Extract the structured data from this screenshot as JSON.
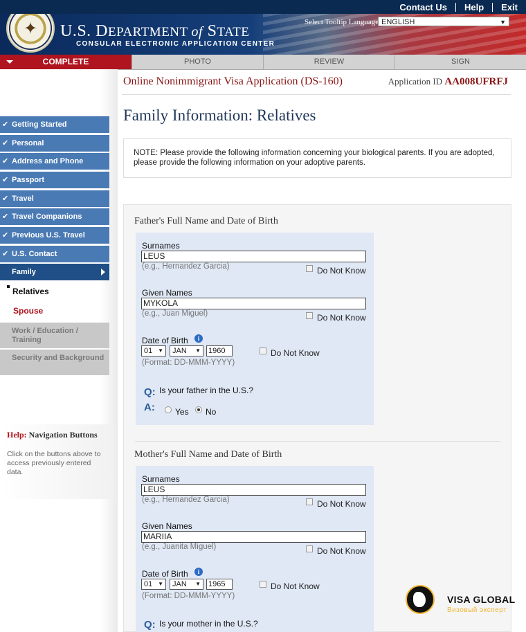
{
  "header": {
    "top_links": [
      "Contact Us",
      "Help",
      "Exit"
    ],
    "dept_prefix": "U.S. D",
    "dept_main": "EPARTMENT ",
    "dept_of": "of",
    "dept_state": " S",
    "dept_state_rest": "TATE",
    "consular": "CONSULAR ELECTRONIC APPLICATION CENTER",
    "tooltip_label": "Select Tooltip Language",
    "tooltip_value": "ENGLISH",
    "seal_icon": "eagle-seal-icon"
  },
  "steps": [
    "COMPLETE",
    "PHOTO",
    "REVIEW",
    "SIGN"
  ],
  "app": {
    "title": "Online Nonimmigrant Visa Application (DS-160)",
    "id_label": "Application ID",
    "id_value": "AA008UFRFJ"
  },
  "page_title": "Family Information: Relatives",
  "note": "NOTE: Please provide the following information concerning your biological parents. If you are adopted, please provide the following information on your adoptive parents.",
  "nav": {
    "completed": [
      "Getting Started",
      "Personal",
      "Address and Phone",
      "Passport",
      "Travel",
      "Travel Companions",
      "Previous U.S. Travel",
      "U.S. Contact"
    ],
    "current": "Family",
    "sub": [
      "Relatives",
      "Spouse"
    ],
    "disabled": [
      "Work / Education / Training",
      "Security and Background"
    ]
  },
  "help": {
    "title_a": "Help:",
    "title_b": " Navigation Buttons",
    "body": "Click on the buttons above to access previously entered data."
  },
  "father": {
    "heading": "Father's Full Name and Date of Birth",
    "surnames_label": "Surnames",
    "surnames_value": "LEUS",
    "surnames_hint": "(e.g., Hernandez Garcia)",
    "given_label": "Given Names",
    "given_value": "MYKOLA",
    "given_hint": "(e.g., Juan Miguel)",
    "dob_label": "Date of Birth",
    "dob_day": "01",
    "dob_month": "JAN",
    "dob_year": "1960",
    "dob_hint": "(Format: DD-MMM-YYYY)",
    "dnk": "Do Not Know",
    "q": "Q:",
    "question": "Is your father in the U.S.?",
    "a": "A:",
    "yes": "Yes",
    "no": "No",
    "selected": "No"
  },
  "mother": {
    "heading": "Mother's Full Name and Date of Birth",
    "surnames_label": "Surnames",
    "surnames_value": "LEUS",
    "surnames_hint": "(e.g., Hernandez Garcia)",
    "given_label": "Given Names",
    "given_value": "MARIIA",
    "given_hint": "(e.g., Juanita Miguel)",
    "dob_label": "Date of Birth",
    "dob_day": "01",
    "dob_month": "JAN",
    "dob_year": "1965",
    "dob_hint": "(Format: DD-MMM-YYYY)",
    "dnk": "Do Not Know",
    "q": "Q:",
    "question": "Is your mother in the U.S.?"
  },
  "watermark": {
    "name": "VISA GLOBAL",
    "sub": "Визовый эксперт"
  },
  "colors": {
    "nav_blue": "#4a7ab4",
    "nav_current": "#1f4f86",
    "accent_red": "#b0141e",
    "header_navy": "#0b2a52"
  }
}
